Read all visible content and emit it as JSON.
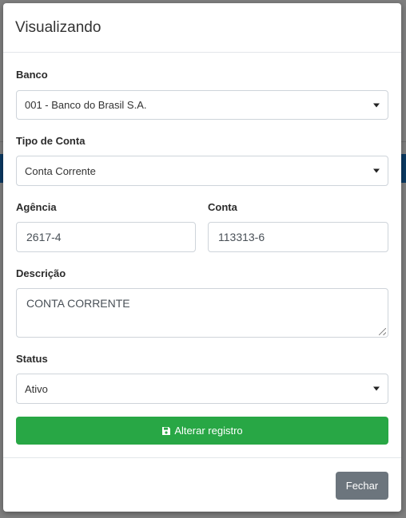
{
  "modal": {
    "title": "Visualizando",
    "fields": {
      "banco": {
        "label": "Banco",
        "value": "001 - Banco do Brasil S.A."
      },
      "tipo_conta": {
        "label": "Tipo de Conta",
        "value": "Conta Corrente"
      },
      "agencia": {
        "label": "Agência",
        "value": "2617-4"
      },
      "conta": {
        "label": "Conta",
        "value": "113313-6"
      },
      "descricao": {
        "label": "Descrição",
        "value": "CONTA CORRENTE"
      },
      "status": {
        "label": "Status",
        "value": "Ativo"
      }
    },
    "save_button": {
      "label": "Alterar registro",
      "icon": "floppy-disk-icon",
      "color": "#28a745"
    },
    "close_button": {
      "label": "Fechar",
      "color": "#6c757d"
    }
  }
}
